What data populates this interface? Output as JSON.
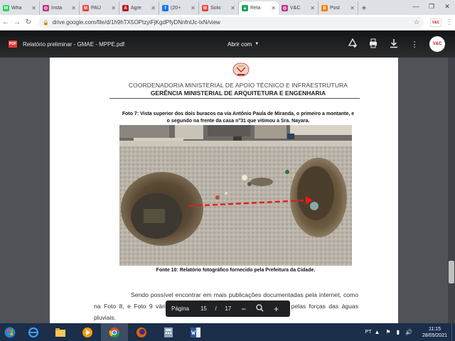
{
  "tabs": [
    {
      "title": "Wha",
      "icon": "whatsapp-icon",
      "color": "#25d366",
      "glyph": "W"
    },
    {
      "title": "Insta",
      "icon": "instagram-icon",
      "color": "#c13584",
      "glyph": "◎"
    },
    {
      "title": "PAU",
      "icon": "gmail-icon",
      "color": "#ea4335",
      "glyph": "M"
    },
    {
      "title": "Agre",
      "icon": "agreste-icon",
      "color": "#b71c1c",
      "glyph": "A"
    },
    {
      "title": "(20+",
      "icon": "facebook-icon",
      "color": "#1877f2",
      "glyph": "f"
    },
    {
      "title": "Solic",
      "icon": "gmail-icon",
      "color": "#ea4335",
      "glyph": "M"
    },
    {
      "title": "Rela",
      "icon": "google-drive-icon",
      "color": "#1fa463",
      "glyph": "▲"
    },
    {
      "title": "V&C",
      "icon": "instagram-icon",
      "color": "#c13584",
      "glyph": "◎"
    },
    {
      "title": "Post",
      "icon": "blogger-icon",
      "color": "#f57d00",
      "glyph": "B"
    }
  ],
  "active_tab_index": 6,
  "address": {
    "url": "drive.google.com/file/d/1h9hTX5OPtzyiFjKgdPfyDNnfnIJc-lxN/view"
  },
  "viewer": {
    "filename": "Relatório preliminar - GMAE - MPPE.pdf",
    "open_with": "Abrir com",
    "logo_text": "V&C"
  },
  "document": {
    "header_line1": "COORDENADORIA MINISTERIAL DE APOIO TÉCNICO E INFRAESTRUTURA",
    "header_line2": "GERÊNCIA MINISTERIAL DE ARQUITETURA E ENGENHARIA",
    "caption": "Foto 7: Vista superior dos dois buracos na via Antônio Paula de Miranda, o primeiro a montante, e o segundo na frente da casa n°31 que vitimou a Sra. Nayara.",
    "source": "Fonte 10: Relatório fotográfico fornecido pela Prefeitura da Cidade.",
    "body": "Sendo possível encontrar em mais publicações documentadas pela internet, como na Foto 8, e Foto 9 vários fissuras com galerias circulares abertas pelas forças das águas pluviais."
  },
  "pager": {
    "label": "Página",
    "current": "15",
    "separator": "/",
    "total": "17"
  },
  "tray": {
    "language": "PT",
    "time": "11:15",
    "date": "28/05/2021"
  }
}
